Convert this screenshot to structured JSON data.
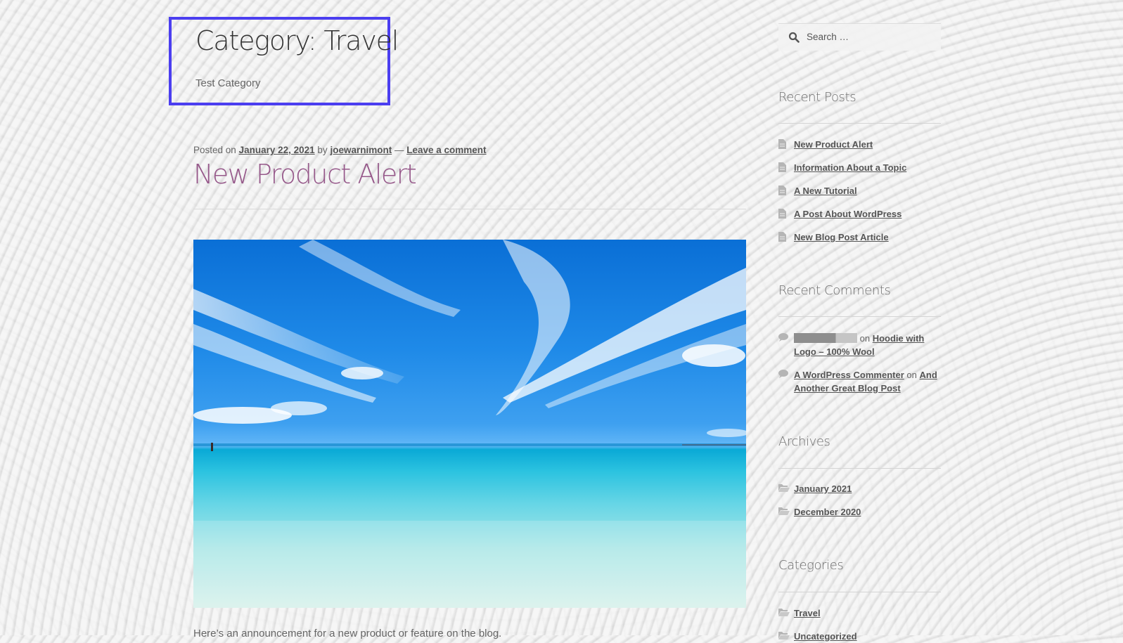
{
  "archive": {
    "title": "Category: Travel",
    "description": "Test Category"
  },
  "post": {
    "meta_prefix": "Posted on",
    "date": "January 22, 2021",
    "by_label": "by",
    "author": "joewarnimont",
    "separator": "—",
    "comment_link": "Leave a comment",
    "title": "New Product Alert",
    "image_alt": "Tropical beach with clear turquoise water and blue sky",
    "excerpt": "Here’s an announcement for a new product or feature on the blog."
  },
  "sidebar": {
    "search": {
      "placeholder": "Search …",
      "value": ""
    },
    "recent_posts": {
      "title": "Recent Posts",
      "items": [
        {
          "label": "New Product Alert"
        },
        {
          "label": "Information About a Topic"
        },
        {
          "label": "A New Tutorial"
        },
        {
          "label": "A Post About WordPress"
        },
        {
          "label": "New Blog Post Article"
        }
      ]
    },
    "recent_comments": {
      "title": "Recent Comments",
      "items": [
        {
          "author": "",
          "author_redacted": true,
          "on_label": "on",
          "post": "Hoodie with Logo – 100% Wool"
        },
        {
          "author": "A WordPress Commenter",
          "author_redacted": false,
          "on_label": "on",
          "post": "And Another Great Blog Post"
        }
      ]
    },
    "archives": {
      "title": "Archives",
      "items": [
        {
          "label": "January 2021"
        },
        {
          "label": "December 2020"
        }
      ]
    },
    "categories": {
      "title": "Categories",
      "items": [
        {
          "label": "Travel"
        },
        {
          "label": "Uncategorized"
        }
      ]
    }
  },
  "colors": {
    "highlight_border": "#4b3ef0",
    "post_title": "#96588a",
    "text": "#6d6d6d",
    "link": "#555555"
  }
}
